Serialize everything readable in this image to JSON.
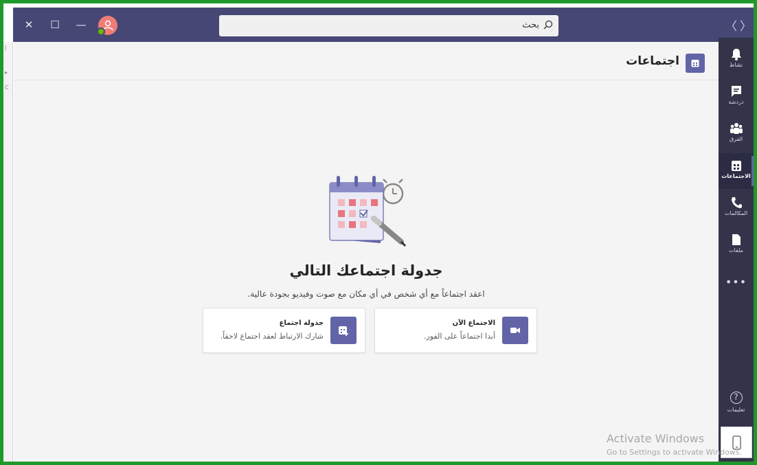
{
  "titlebar": {
    "close_glyph": "✕",
    "maximize_glyph": "☐",
    "minimize_glyph": "—",
    "search_placeholder": "بحث",
    "nav_back": "〈",
    "nav_forward": "〉"
  },
  "header": {
    "title": "اجتماعات"
  },
  "appbar": {
    "items": [
      {
        "label": "نشاط",
        "icon": "bell-icon"
      },
      {
        "label": "دردشة",
        "icon": "chat-icon"
      },
      {
        "label": "الفرق",
        "icon": "teams-icon"
      },
      {
        "label": "الاجتماعات",
        "icon": "calendar-icon",
        "active": true
      },
      {
        "label": "المكالمات",
        "icon": "phone-icon"
      },
      {
        "label": "ملفات",
        "icon": "file-icon"
      }
    ],
    "more": "•••",
    "help_label": "تعليمات",
    "help_glyph": "?"
  },
  "main": {
    "headline": "جدولة اجتماعك التالي",
    "subline": "اعقد اجتماعاً مع أي شخص في أي مكان مع صوت وفيديو بجودة عالية.",
    "cards": [
      {
        "title": "الاجتماع الآن",
        "subtitle": "أبدا اجتماعاً على الفور.",
        "icon": "video-icon"
      },
      {
        "title": "جدولة اجتماع",
        "subtitle": "شارك الارتباط لعقد اجتماع لاحقاً.",
        "icon": "calendar-add-icon"
      }
    ]
  },
  "watermark": {
    "line1": "Activate Windows",
    "line2": "Go to Settings to activate Windows."
  },
  "colors": {
    "brand": "#6264a7",
    "titlebar": "#464775",
    "appbar": "#33344a",
    "border": "#1f9a2a"
  }
}
